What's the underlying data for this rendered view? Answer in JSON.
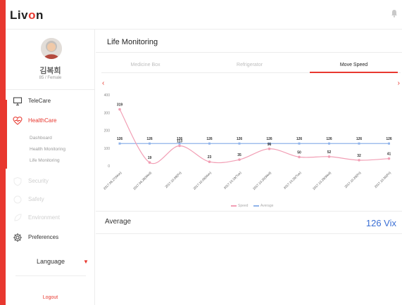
{
  "app": {
    "logo_prefix": "Liv",
    "logo_accent": "o",
    "logo_suffix": "n"
  },
  "profile": {
    "name": "김복희",
    "meta": "85 / Female"
  },
  "nav": {
    "telecare": "TeleCare",
    "healthcare": "HealthCare",
    "sub_items": [
      "Dashboard",
      "Health Monitoring",
      "Life Monitoring"
    ],
    "security": "Security",
    "safety": "Safety",
    "environment": "Environment",
    "preferences": "Preferences",
    "language": "Language",
    "logout": "Logout"
  },
  "page": {
    "title": "Life Monitoring",
    "tabs": [
      "Medicine Box",
      "Refrigerator",
      "Move Speed"
    ],
    "active_tab": 2,
    "prev_arrow": "‹",
    "next_arrow": "›"
  },
  "colors": {
    "accent": "#e8382f",
    "speed_line": "#f29fb5",
    "average_line": "#8fb3ea",
    "average_value": "#3b6fd4"
  },
  "chart_data": {
    "type": "line",
    "categories": [
      "2017.06.27(Mon)",
      "2017.06.28(Wed)",
      "2017.10.08(Fri)",
      "2017.10.09(Mon)",
      "2017.10.19(Tue)",
      "2017.10.20(Wed)",
      "2017.10.26(Tue)",
      "2017.10.29(Wed)",
      "2017.10.29(Fri)",
      "2017.10.30(Fri)"
    ],
    "series": [
      {
        "name": "Speed",
        "values": [
          319,
          19,
          113,
          23,
          35,
          96,
          50,
          52,
          32,
          41
        ]
      },
      {
        "name": "Average",
        "values": [
          126,
          126,
          126,
          126,
          126,
          126,
          126,
          126,
          126,
          126
        ]
      }
    ],
    "yticks": [
      0,
      100,
      200,
      300,
      400
    ],
    "ylim": [
      0,
      400
    ],
    "legend": [
      "Speed",
      "Average"
    ]
  },
  "summary": {
    "label": "Average",
    "value": "126 Vix"
  }
}
